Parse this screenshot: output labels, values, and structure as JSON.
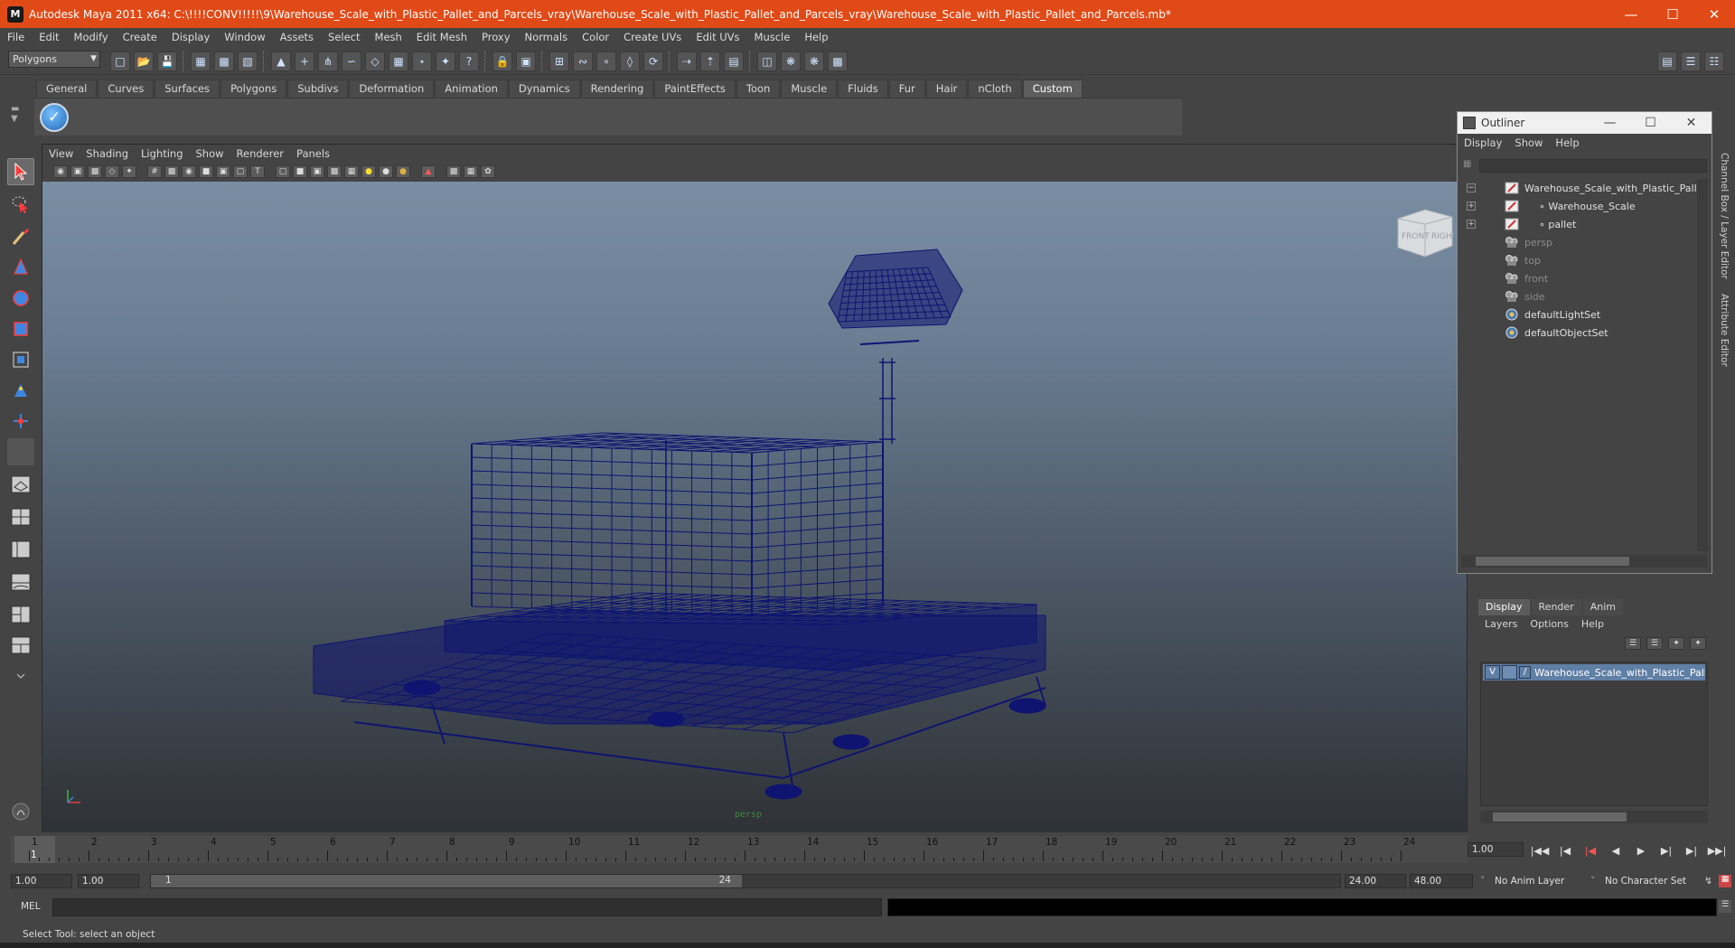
{
  "window": {
    "title": "Autodesk Maya 2011 x64: C:\\!!!!CONV!!!!!\\9\\Warehouse_Scale_with_Plastic_Pallet_and_Parcels_vray\\Warehouse_Scale_with_Plastic_Pallet_and_Parcels_vray\\Warehouse_Scale_with_Plastic_Pallet_and_Parcels.mb*",
    "icon": "maya-icon",
    "controls": [
      "minimize-icon",
      "maximize-icon",
      "close-icon"
    ]
  },
  "menubar": [
    "File",
    "Edit",
    "Modify",
    "Create",
    "Display",
    "Window",
    "Assets",
    "Select",
    "Mesh",
    "Edit Mesh",
    "Proxy",
    "Normals",
    "Color",
    "Create UVs",
    "Edit UVs",
    "Muscle",
    "Help"
  ],
  "statusline": {
    "mode": "Polygons"
  },
  "shelf": {
    "tabs": [
      "General",
      "Curves",
      "Surfaces",
      "Polygons",
      "Subdivs",
      "Deformation",
      "Animation",
      "Dynamics",
      "Rendering",
      "PaintEffects",
      "Toon",
      "Muscle",
      "Fluids",
      "Fur",
      "Hair",
      "nCloth",
      "Custom"
    ],
    "active_tab": "Custom",
    "items": [
      "check-icon"
    ]
  },
  "viewport": {
    "menu": [
      "View",
      "Shading",
      "Lighting",
      "Show",
      "Renderer",
      "Panels"
    ],
    "camera_label": "persp",
    "viewcube": {
      "front": "FRONT",
      "right": "RIGHT"
    },
    "wire_color": "#0e1470"
  },
  "outliner": {
    "title": "Outliner",
    "menu": [
      "Display",
      "Show",
      "Help"
    ],
    "items": [
      {
        "label": "Warehouse_Scale_with_Plastic_Pallet_a",
        "icon": "transform-icon",
        "expanded": true,
        "dim": false
      },
      {
        "label": "Warehouse_Scale",
        "icon": "transform-icon",
        "expanded": false,
        "dim": false
      },
      {
        "label": "pallet",
        "icon": "transform-icon",
        "expanded": false,
        "dim": false
      },
      {
        "label": "persp",
        "icon": "camera-icon",
        "dim": true
      },
      {
        "label": "top",
        "icon": "camera-icon",
        "dim": true
      },
      {
        "label": "front",
        "icon": "camera-icon",
        "dim": true
      },
      {
        "label": "side",
        "icon": "camera-icon",
        "dim": true
      },
      {
        "label": "defaultLightSet",
        "icon": "set-icon",
        "dim": false
      },
      {
        "label": "defaultObjectSet",
        "icon": "set-icon",
        "dim": false
      }
    ]
  },
  "dock": {
    "channel_box_label": "Channel Box / Layer Editor",
    "attribute_editor_label": "Attribute Editor"
  },
  "layer_editor": {
    "tabs": [
      "Display",
      "Render",
      "Anim"
    ],
    "active_tab": "Display",
    "menu": [
      "Layers",
      "Options",
      "Help"
    ],
    "layer": {
      "visible": "V",
      "name": "Warehouse_Scale_with_Plastic_Pallet"
    }
  },
  "timeline": {
    "ticks": [
      "1",
      "2",
      "3",
      "4",
      "5",
      "6",
      "7",
      "8",
      "9",
      "10",
      "11",
      "12",
      "13",
      "14",
      "15",
      "16",
      "17",
      "18",
      "19",
      "20",
      "21",
      "22",
      "23",
      "24"
    ],
    "current_frame_marker": "1",
    "current_time": "1.00"
  },
  "range": {
    "start_time": "1.00",
    "playback_start": "1.00",
    "range_start": "1",
    "range_end": "24",
    "playback_end": "24.00",
    "end_time": "48.00",
    "anim_layer": "No Anim Layer",
    "character_set": "No Character Set"
  },
  "command": {
    "label": "MEL",
    "input": "",
    "output": ""
  },
  "help_line": "Select Tool: select an object"
}
